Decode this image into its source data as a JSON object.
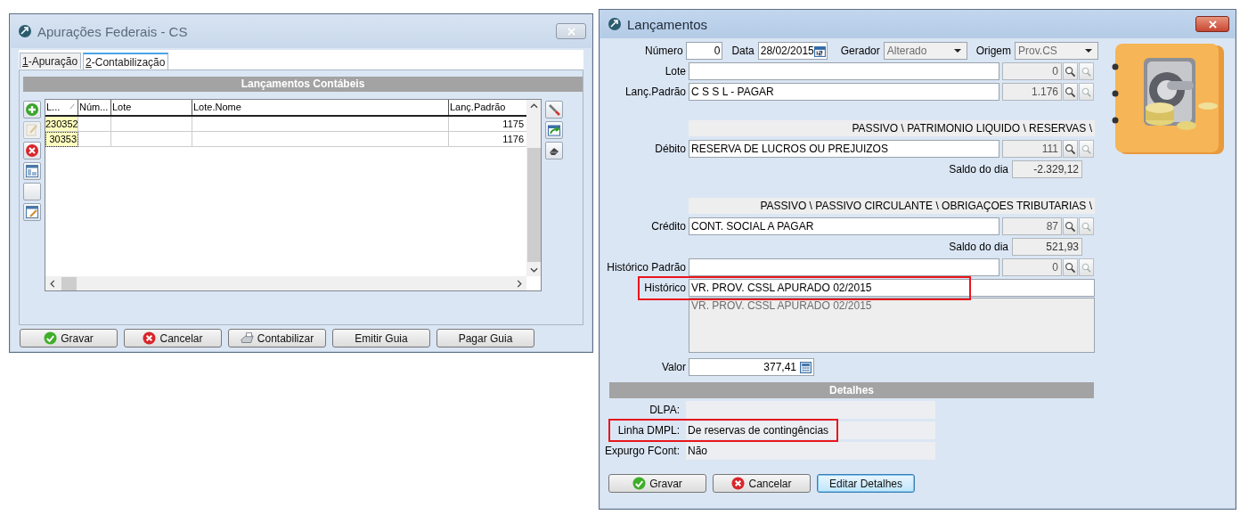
{
  "left_window": {
    "title": "Apurações Federais - CS",
    "active": false,
    "tabs": [
      {
        "label": "1-Apuração",
        "selected": false
      },
      {
        "label": "2-Contabilização",
        "selected": true
      }
    ],
    "section_title": "Lançamentos Contábeis",
    "toolbar_left": [
      {
        "kind": "add",
        "disabled": false
      },
      {
        "kind": "edit",
        "disabled": true
      },
      {
        "kind": "delete",
        "disabled": false
      },
      {
        "kind": "layout",
        "disabled": false
      },
      {
        "kind": "blank",
        "disabled": false
      },
      {
        "kind": "edit-layout",
        "disabled": false
      }
    ],
    "toolbar_right": [
      {
        "kind": "tool"
      },
      {
        "kind": "export"
      },
      {
        "kind": "eraser"
      }
    ],
    "grid": {
      "columns": [
        "L...",
        "Núm...",
        "Lote",
        "Lote.Nome",
        "Lanç.Padrão"
      ],
      "rows": [
        {
          "l": "230352",
          "lanc_padrao": "1175",
          "focused": false
        },
        {
          "l": "30353",
          "lanc_padrao": "1176",
          "focused": true
        }
      ]
    },
    "buttons": [
      {
        "label": "Gravar",
        "kind": "confirm"
      },
      {
        "label": "Cancelar",
        "kind": "cancel"
      },
      {
        "label": "Contabilizar",
        "kind": "post"
      },
      {
        "label": "Emitir Guia",
        "kind": "plain"
      },
      {
        "label": "Pagar Guia",
        "kind": "plain"
      }
    ]
  },
  "right_window": {
    "title": "Lançamentos",
    "active": true,
    "numero": {
      "label": "Número",
      "value": "0"
    },
    "data": {
      "label": "Data",
      "value": "28/02/2015"
    },
    "gerador": {
      "label": "Gerador",
      "value": "Alterado",
      "disabled": true
    },
    "origem": {
      "label": "Origem",
      "value": "Prov.CS",
      "disabled": true
    },
    "lote": {
      "label": "Lote",
      "code": "0"
    },
    "lanc_padrao": {
      "label": "Lanç.Padrão",
      "value": "C S S L -  PAGAR",
      "code": "1.176"
    },
    "debito": {
      "path": "PASSIVO \\ PATRIMONIO LIQUIDO \\ RESERVAS \\",
      "label": "Débito",
      "value": "RESERVA DE LUCROS OU PREJUIZOS",
      "code": "111",
      "balance_label": "Saldo do dia",
      "balance": "-2.329,12"
    },
    "credito": {
      "path": "PASSIVO \\ PASSIVO CIRCULANTE \\ OBRIGAÇOES TRIBUTARIAS \\",
      "label": "Crédito",
      "value": "CONT. SOCIAL A PAGAR",
      "code": "87",
      "balance_label": "Saldo do dia",
      "balance": "521,93"
    },
    "historico_padrao": {
      "label": "Histórico Padrão",
      "code": "0"
    },
    "historico": {
      "label": "Histórico",
      "value": "VR. PROV. CSSL APURADO 02/2015",
      "highlighted": true
    },
    "memo": "VR. PROV. CSSL APURADO 02/2015",
    "valor": {
      "label": "Valor",
      "value": "377,41"
    },
    "details": {
      "title": "Detalhes",
      "rows": [
        {
          "label": "DLPA:",
          "highlighted": false
        },
        {
          "label": "Linha DMPL:",
          "value": "De reservas de contingências",
          "highlighted": true
        },
        {
          "label": "Expurgo FCont:",
          "value": "Não",
          "highlighted": false
        }
      ]
    },
    "buttons": [
      {
        "label": "Gravar",
        "kind": "confirm",
        "default": false
      },
      {
        "label": "Cancelar",
        "kind": "cancel",
        "default": false
      },
      {
        "label": "Editar Detalhes",
        "kind": "plain",
        "default": true
      }
    ]
  }
}
